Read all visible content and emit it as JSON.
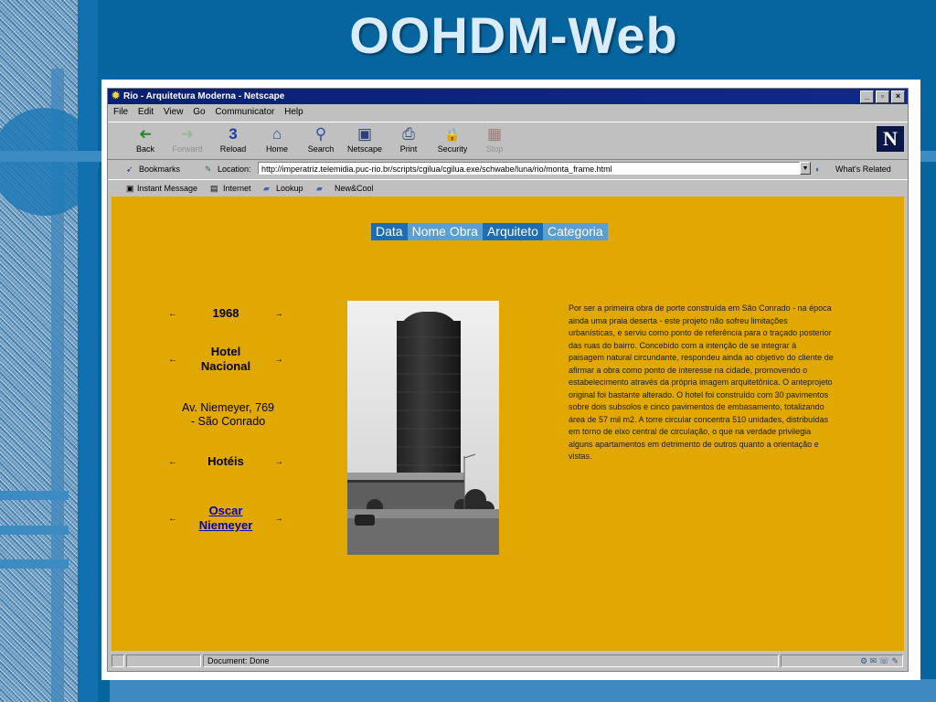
{
  "slide": {
    "title": "OOHDM-Web"
  },
  "browser": {
    "window_title": "Rio - Arquitetura Moderna - Netscape",
    "window_buttons": [
      "_",
      "▫",
      "×"
    ],
    "menu": [
      "File",
      "Edit",
      "View",
      "Go",
      "Communicator",
      "Help"
    ],
    "toolbar": [
      {
        "label": "Back",
        "icon": "back-arrow-icon",
        "glyph": "➜",
        "enabled": true
      },
      {
        "label": "Forward",
        "icon": "forward-arrow-icon",
        "glyph": "➜",
        "enabled": false
      },
      {
        "label": "Reload",
        "icon": "reload-icon",
        "glyph": "3",
        "enabled": true
      },
      {
        "label": "Home",
        "icon": "home-icon",
        "glyph": "⌂",
        "enabled": true
      },
      {
        "label": "Search",
        "icon": "search-icon",
        "glyph": "⚲",
        "enabled": true
      },
      {
        "label": "Netscape",
        "icon": "netscape-icon",
        "glyph": "▣",
        "enabled": true
      },
      {
        "label": "Print",
        "icon": "print-icon",
        "glyph": "⎙",
        "enabled": true
      },
      {
        "label": "Security",
        "icon": "lock-icon",
        "glyph": "🔒",
        "enabled": true
      },
      {
        "label": "Stop",
        "icon": "stop-icon",
        "glyph": "▦",
        "enabled": false
      }
    ],
    "logo_letter": "N",
    "bookmarks_label": "Bookmarks",
    "location_label": "Location:",
    "url": "http://imperatriz.telemidia.puc-rio.br/scripts/cgilua/cgilua.exe/schwabe/luna/rio/monta_frame.html",
    "whats_related": "What's Related",
    "personal": [
      "Instant Message",
      "Internet",
      "Lookup",
      "New&Cool"
    ],
    "status_text": "Document: Done"
  },
  "page": {
    "nav": [
      "Data",
      "Nome Obra",
      "Arquiteto",
      "Categoria"
    ],
    "prev_arrow": "←",
    "next_arrow": "→",
    "year": "1968",
    "building_name_line1": "Hotel",
    "building_name_line2": "Nacional",
    "address_line1": "Av. Niemeyer, 769",
    "address_line2": "- São Conrado",
    "category": "Hotéis",
    "architect_line1": "Oscar",
    "architect_line2": "Niemeyer",
    "description": "Por ser a primeira obra de porte construída em São Conrado - na época ainda uma praia deserta - este projeto não sofreu limitações urbanísticas, e serviu como ponto de referência para o traçado posterior das ruas do bairro. Concebido com a intenção de se integrar à paisagem natural circundante, respondeu ainda ao objetivo do cliente de afirmar a obra como ponto de interesse na cidade, promovendo o estabelecimento através da própria imagem arquitetônica. O anteprojeto original foi bastante alterado. O hotel foi construído com 30 pavimentos sobre dois subsolos e cinco pavimentos de embasamento, totalizando área de 57 mil m2. A torre circular concentra 510 unidades, distribuídas em torno de eixo central de circulação, o que na verdade privilegia alguns apartamentos em detrimento de outros quanto a orientação e vistas."
  }
}
